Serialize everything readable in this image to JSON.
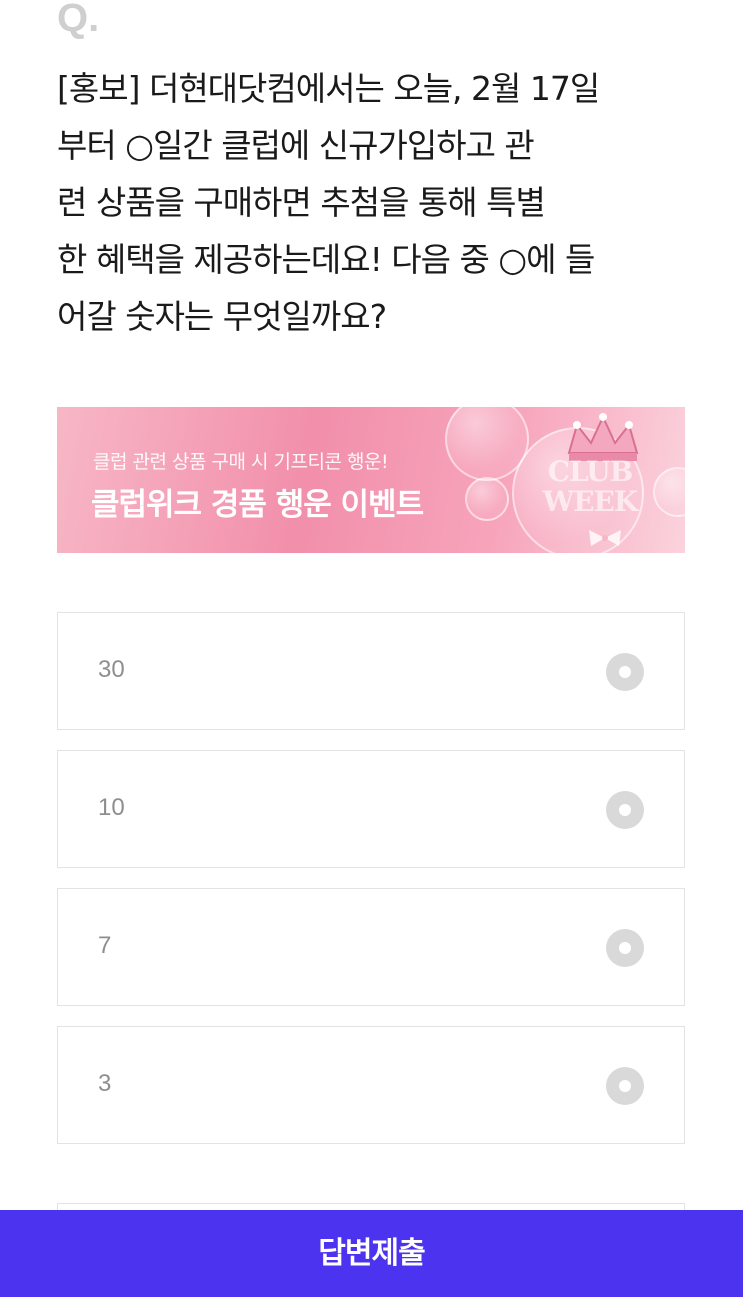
{
  "quiz": {
    "q_label": "Q.",
    "question_lines": [
      "[홍보] 더현대닷컴에서는 오늘, 2월 17일",
      "부터 ○일간 클럽에 신규가입하고 관",
      "련 상품을 구매하면 추첨을 통해 특별",
      "한 혜택을 제공하는데요! 다음 중 ○에 들",
      "어갈 숫자는 무엇일까요?"
    ]
  },
  "banner": {
    "subtitle": "클럽 관련 상품 구매 시 기프티콘 행운!",
    "title": "클럽위크 경품 행운 이벤트",
    "logo_line1": "CLUB",
    "logo_line2": "WEEK",
    "colors": {
      "from": "#f7b7c6",
      "to": "#fbd3dd"
    }
  },
  "options": [
    {
      "label": "30",
      "selected": false
    },
    {
      "label": "10",
      "selected": false
    },
    {
      "label": "7",
      "selected": false
    },
    {
      "label": "3",
      "selected": false
    }
  ],
  "submit": {
    "label": "답변제출",
    "color": "#4c33f0"
  }
}
